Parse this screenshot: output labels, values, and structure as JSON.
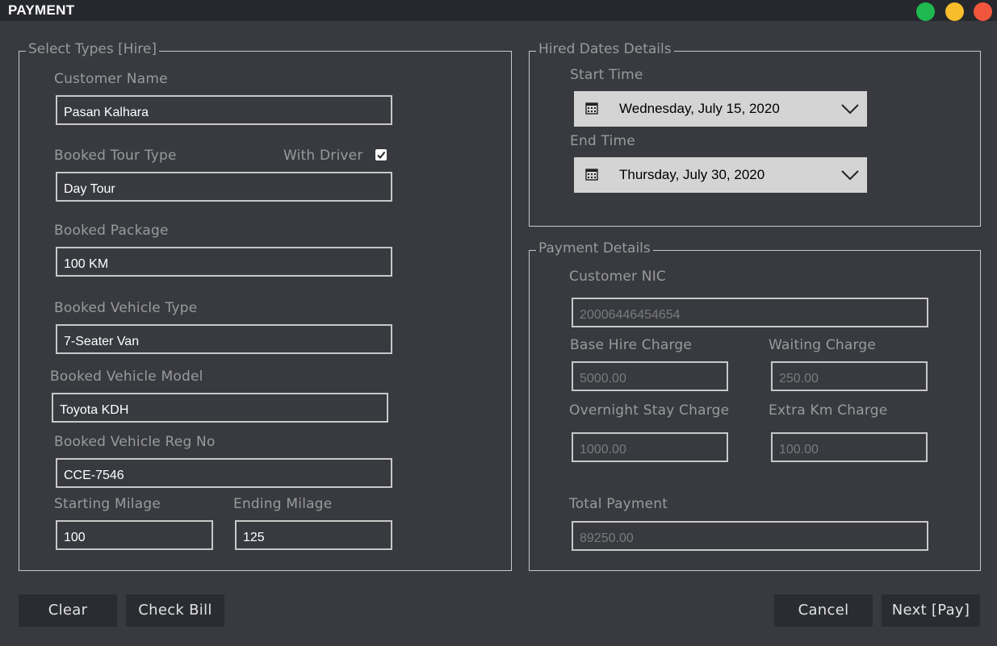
{
  "window": {
    "title": "PAYMENT"
  },
  "hire_panel": {
    "legend": "Select Types [Hire]",
    "customer_name": {
      "label": "Customer Name",
      "value": "Pasan Kalhara"
    },
    "tour_type": {
      "label": "Booked Tour Type",
      "value": "Day Tour"
    },
    "with_driver": {
      "label": "With Driver",
      "checked": true
    },
    "package": {
      "label": "Booked Package",
      "value": "100 KM"
    },
    "vehicle_type": {
      "label": "Booked Vehicle Type",
      "value": "7-Seater Van"
    },
    "vehicle_model": {
      "label": "Booked Vehicle Model",
      "value": "Toyota KDH"
    },
    "vehicle_reg": {
      "label": "Booked Vehicle Reg No",
      "value": "CCE-7546"
    },
    "starting_milage": {
      "label": "Starting Milage",
      "value": "100"
    },
    "ending_milage": {
      "label": "Ending Milage",
      "value": "125"
    }
  },
  "dates_panel": {
    "legend": "Hired Dates Details",
    "start": {
      "label": "Start Time",
      "value": "Wednesday, July 15, 2020"
    },
    "end": {
      "label": "End Time",
      "value": "Thursday, July 30, 2020"
    }
  },
  "payment_panel": {
    "legend": "Payment Details",
    "nic": {
      "label": "Customer NIC",
      "value": "20006446454654"
    },
    "base_hire": {
      "label": "Base Hire Charge",
      "value": "5000.00"
    },
    "waiting": {
      "label": "Waiting Charge",
      "value": "250.00"
    },
    "overnight": {
      "label": "Overnight Stay Charge",
      "value": "1000.00"
    },
    "extra_km": {
      "label": "Extra Km Charge",
      "value": "100.00"
    },
    "total": {
      "label": "Total Payment",
      "value": "89250.00"
    }
  },
  "buttons": {
    "clear": "Clear",
    "check_bill": "Check Bill",
    "cancel": "Cancel",
    "next": "Next [Pay]"
  },
  "colors": {
    "background": "#383a40",
    "titlebar": "#26282d",
    "window_green": "#1fb851",
    "window_yellow": "#f7bd2a",
    "window_red": "#f0563c"
  }
}
